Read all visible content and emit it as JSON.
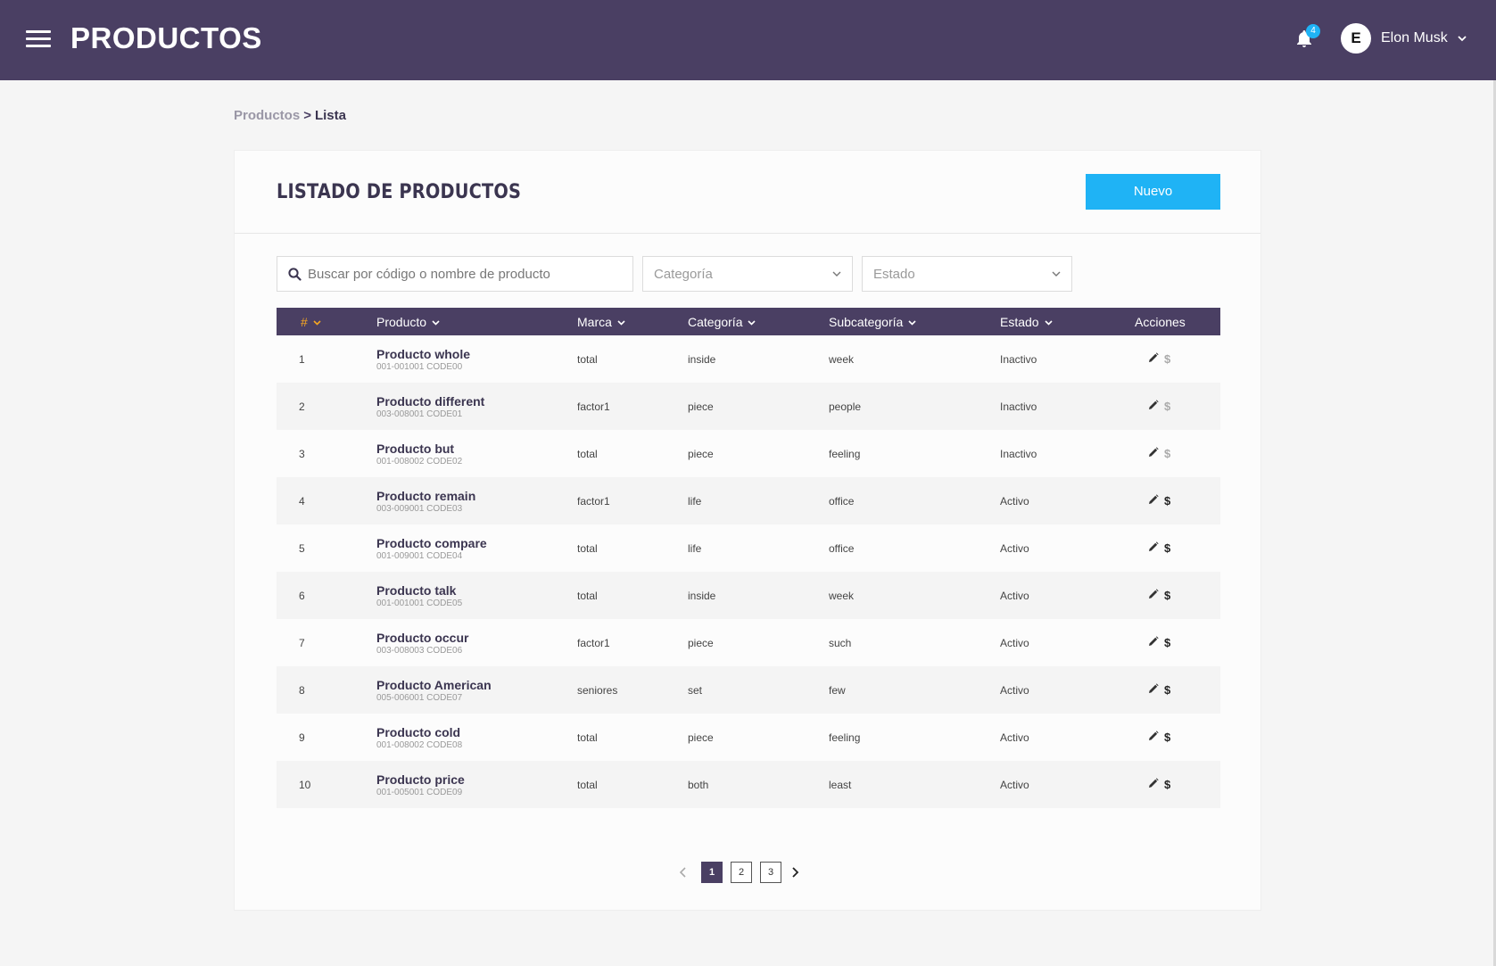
{
  "header": {
    "title": "PRODUCTOS",
    "notifications_count": "4",
    "user_initial": "E",
    "user_name": "Elon Musk"
  },
  "breadcrumb": {
    "parent": "Productos",
    "separator": ">",
    "current": "Lista"
  },
  "card": {
    "title": "LISTADO DE PRODUCTOS",
    "new_button": "Nuevo"
  },
  "filters": {
    "search_placeholder": "Buscar por código o nombre de producto",
    "category_placeholder": "Categoría",
    "status_placeholder": "Estado"
  },
  "table": {
    "columns": [
      "#",
      "Producto",
      "Marca",
      "Categoría",
      "Subcategoría",
      "Estado",
      "Acciones"
    ],
    "rows": [
      {
        "num": "1",
        "name": "Producto whole",
        "code": "001-001001 CODE00",
        "brand": "total",
        "category": "inside",
        "subcategory": "week",
        "status": "Inactivo",
        "price_enabled": false
      },
      {
        "num": "2",
        "name": "Producto different",
        "code": "003-008001 CODE01",
        "brand": "factor1",
        "category": "piece",
        "subcategory": "people",
        "status": "Inactivo",
        "price_enabled": false
      },
      {
        "num": "3",
        "name": "Producto but",
        "code": "001-008002 CODE02",
        "brand": "total",
        "category": "piece",
        "subcategory": "feeling",
        "status": "Inactivo",
        "price_enabled": false
      },
      {
        "num": "4",
        "name": "Producto remain",
        "code": "003-009001 CODE03",
        "brand": "factor1",
        "category": "life",
        "subcategory": "office",
        "status": "Activo",
        "price_enabled": true
      },
      {
        "num": "5",
        "name": "Producto compare",
        "code": "001-009001 CODE04",
        "brand": "total",
        "category": "life",
        "subcategory": "office",
        "status": "Activo",
        "price_enabled": true
      },
      {
        "num": "6",
        "name": "Producto talk",
        "code": "001-001001 CODE05",
        "brand": "total",
        "category": "inside",
        "subcategory": "week",
        "status": "Activo",
        "price_enabled": true
      },
      {
        "num": "7",
        "name": "Producto occur",
        "code": "003-008003 CODE06",
        "brand": "factor1",
        "category": "piece",
        "subcategory": "such",
        "status": "Activo",
        "price_enabled": true
      },
      {
        "num": "8",
        "name": "Producto American",
        "code": "005-006001 CODE07",
        "brand": "seniores",
        "category": "set",
        "subcategory": "few",
        "status": "Activo",
        "price_enabled": true
      },
      {
        "num": "9",
        "name": "Producto cold",
        "code": "001-008002 CODE08",
        "brand": "total",
        "category": "piece",
        "subcategory": "feeling",
        "status": "Activo",
        "price_enabled": true
      },
      {
        "num": "10",
        "name": "Producto price",
        "code": "001-005001 CODE09",
        "brand": "total",
        "category": "both",
        "subcategory": "least",
        "status": "Activo",
        "price_enabled": true
      }
    ],
    "price_symbol": "$"
  },
  "pagination": {
    "pages": [
      "1",
      "2",
      "3"
    ],
    "current": "1"
  },
  "colors": {
    "header_bg": "#4a3f63",
    "accent": "#1fb3f5",
    "sort_active": "#f5a623"
  },
  "icons": [
    "menu-icon",
    "bell-icon",
    "chevron-down-icon",
    "search-icon",
    "edit-icon",
    "chevron-left-icon",
    "chevron-right-icon"
  ]
}
